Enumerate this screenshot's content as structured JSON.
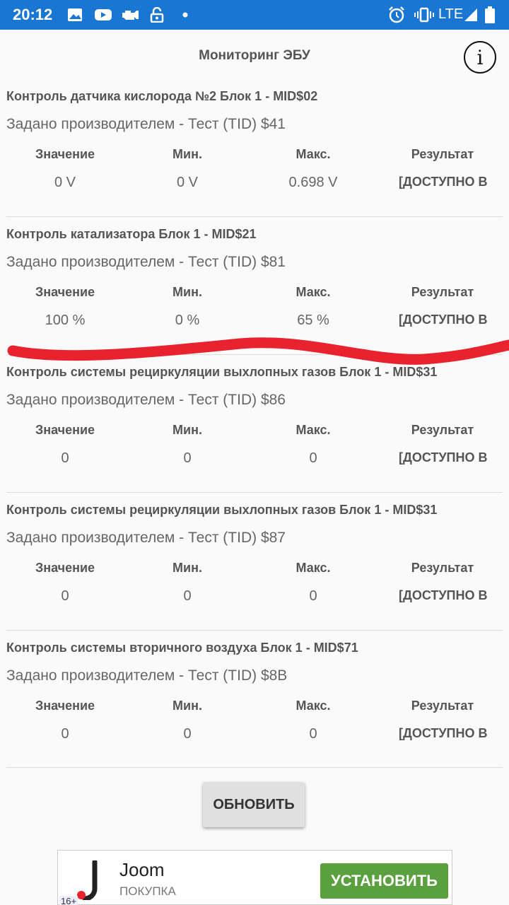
{
  "status_bar": {
    "time": "20:12",
    "network": "LTE",
    "icons": [
      "image-icon",
      "youtube-icon",
      "engine-icon",
      "lock-icon",
      "dot-icon",
      "alarm-icon",
      "vibrate-icon",
      "signal-icon",
      "battery-icon"
    ]
  },
  "header": {
    "title": "Мониторинг ЭБУ",
    "info_label": "i"
  },
  "columns": {
    "value": "Значение",
    "min": "Мин.",
    "max": "Макс.",
    "result": "Результат"
  },
  "sections": [
    {
      "title": "Контроль датчика кислорода №2 Блок 1 - MID$02",
      "subtitle": "Задано производителем - Тест (TID) $41",
      "value": "0  V",
      "min": "0  V",
      "max": "0.698  V",
      "result": "[ДОСТУПНО В"
    },
    {
      "title": "Контроль катализатора Блок 1 - MID$21",
      "subtitle": "Задано производителем - Тест (TID) $81",
      "value": "100  %",
      "min": "0  %",
      "max": "65  %",
      "result": "[ДОСТУПНО В"
    },
    {
      "title": "Контроль системы рециркуляции выхлопных газов Блок 1 - MID$31",
      "subtitle": "Задано производителем - Тест (TID) $86",
      "value": "0",
      "min": "0",
      "max": "0",
      "result": "[ДОСТУПНО В"
    },
    {
      "title": "Контроль системы рециркуляции выхлопных газов Блок 1 - MID$31",
      "subtitle": "Задано производителем - Тест (TID) $87",
      "value": "0",
      "min": "0",
      "max": "0",
      "result": "[ДОСТУПНО В"
    },
    {
      "title": "Контроль системы вторичного воздуха Блок 1 - MID$71",
      "subtitle": "Задано производителем - Тест (TID) $8B",
      "value": "0",
      "min": "0",
      "max": "0",
      "result": "[ДОСТУПНО В"
    }
  ],
  "refresh_label": "ОБНОВИТЬ",
  "ad": {
    "name": "Joom",
    "category": "ПОКУПКА",
    "install_label": "УСТАНОВИТЬ",
    "age": "16+"
  },
  "colors": {
    "status_bar": "#1976d2",
    "install_button": "#5aa03e",
    "scribble": "#e8222e"
  }
}
